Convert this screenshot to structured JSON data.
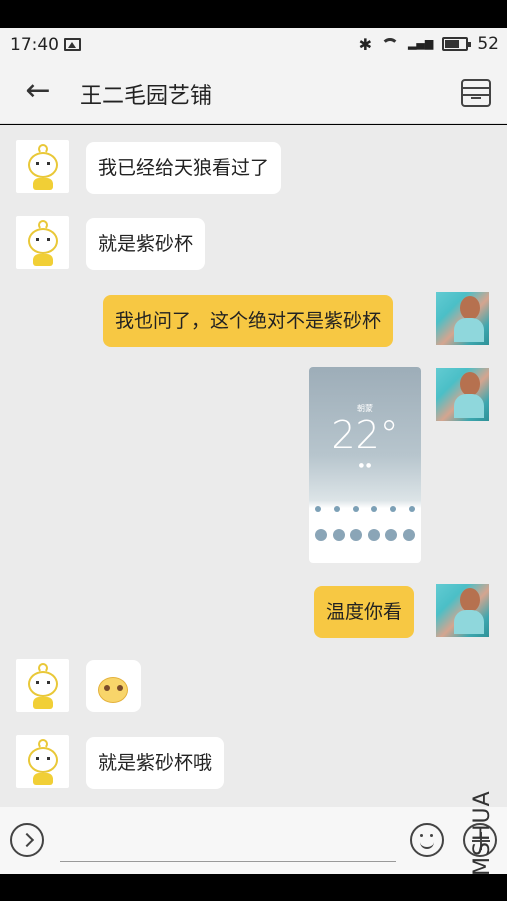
{
  "status": {
    "time": "17:40",
    "battery": "52"
  },
  "header": {
    "title": "王二毛园艺铺"
  },
  "messages": [
    {
      "side": "left",
      "text": "我已经给天狼看过了"
    },
    {
      "side": "left",
      "text": "就是紫砂杯"
    },
    {
      "side": "right",
      "text": "我也问了，这个绝对不是紫砂杯"
    },
    {
      "side": "right",
      "image": "weather-screenshot"
    },
    {
      "side": "right",
      "text": "温度你看"
    },
    {
      "side": "left",
      "emoji": "blushing-face"
    },
    {
      "side": "left",
      "text": "就是紫砂杯哦"
    }
  ],
  "weather_image": {
    "city": "朝蒙",
    "temperature": "22°"
  },
  "watermark": "MSHUA"
}
